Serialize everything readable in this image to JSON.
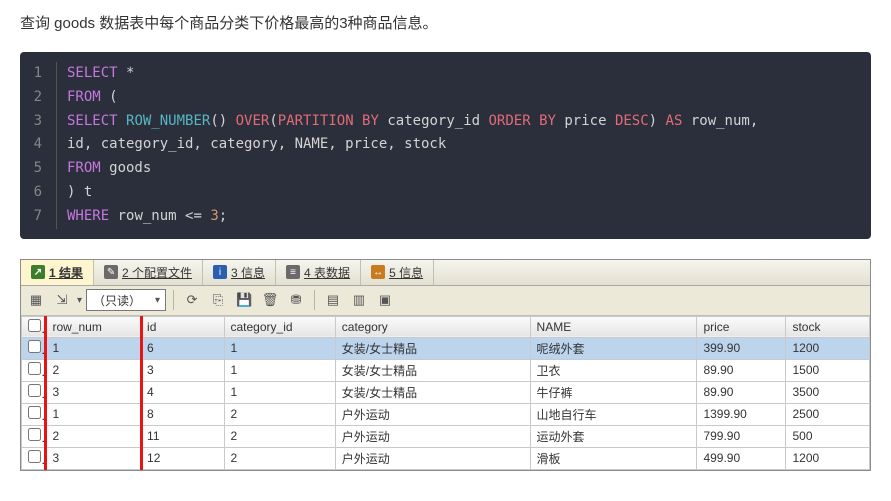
{
  "description": "查询 goods 数据表中每个商品分类下价格最高的3种商品信息。",
  "code": {
    "lines": [
      {
        "n": "1",
        "html": "<span class='kw1'>SELECT</span> <span class='star'>*</span>"
      },
      {
        "n": "2",
        "html": "<span class='kw1'>FROM</span> <span class='paren'>(</span>"
      },
      {
        "n": "3",
        "html": "<span class='kw1'>SELECT</span> <span class='fn'>ROW_NUMBER</span><span class='paren'>()</span> <span class='kw2'>OVER</span><span class='paren'>(</span><span class='kw2'>PARTITION BY</span> category_id <span class='kw2'>ORDER BY</span> price <span class='kw2'>DESC</span><span class='paren'>)</span> <span class='kw2'>AS</span> row_num,"
      },
      {
        "n": "4",
        "html": "id, category_id, category, NAME, price, stock"
      },
      {
        "n": "5",
        "html": "<span class='kw1'>FROM</span> goods"
      },
      {
        "n": "6",
        "html": "<span class='paren'>)</span> t"
      },
      {
        "n": "7",
        "html": "<span class='kw1'>WHERE</span> row_num <span class='op'>&lt;=</span> <span class='num'>3</span>;"
      }
    ]
  },
  "tabs": {
    "t1": {
      "icon_text": "↗",
      "label": "1 结果"
    },
    "t2": {
      "icon_text": "✎",
      "label": "2 个配置文件"
    },
    "t3": {
      "icon_text": "i",
      "label": "3 信息"
    },
    "t4": {
      "icon_text": "≡",
      "label": "4 表数据"
    },
    "t5": {
      "icon_text": "↔",
      "label": "5 信息"
    }
  },
  "toolbar": {
    "dropdown_label": "（只读）"
  },
  "grid": {
    "headers": {
      "row_num": "row_num",
      "id": "id",
      "category_id": "category_id",
      "category": "category",
      "name": "NAME",
      "price": "price",
      "stock": "stock"
    },
    "rows": [
      {
        "row_num": "1",
        "id": "6",
        "category_id": "1",
        "category": "女装/女士精品",
        "name": "呢绒外套",
        "price": "399.90",
        "stock": "1200",
        "selected": true
      },
      {
        "row_num": "2",
        "id": "3",
        "category_id": "1",
        "category": "女装/女士精品",
        "name": "卫衣",
        "price": "89.90",
        "stock": "1500"
      },
      {
        "row_num": "3",
        "id": "4",
        "category_id": "1",
        "category": "女装/女士精品",
        "name": "牛仔裤",
        "price": "89.90",
        "stock": "3500"
      },
      {
        "row_num": "1",
        "id": "8",
        "category_id": "2",
        "category": "户外运动",
        "name": "山地自行车",
        "price": "1399.90",
        "stock": "2500"
      },
      {
        "row_num": "2",
        "id": "11",
        "category_id": "2",
        "category": "户外运动",
        "name": "运动外套",
        "price": "799.90",
        "stock": "500"
      },
      {
        "row_num": "3",
        "id": "12",
        "category_id": "2",
        "category": "户外运动",
        "name": "滑板",
        "price": "499.90",
        "stock": "1200"
      }
    ]
  },
  "chart_data": {
    "type": "table",
    "title": "Top 3 priced goods per category",
    "columns": [
      "row_num",
      "id",
      "category_id",
      "category",
      "NAME",
      "price",
      "stock"
    ],
    "data": [
      [
        1,
        6,
        1,
        "女装/女士精品",
        "呢绒外套",
        399.9,
        1200
      ],
      [
        2,
        3,
        1,
        "女装/女士精品",
        "卫衣",
        89.9,
        1500
      ],
      [
        3,
        4,
        1,
        "女装/女士精品",
        "牛仔裤",
        89.9,
        3500
      ],
      [
        1,
        8,
        2,
        "户外运动",
        "山地自行车",
        1399.9,
        2500
      ],
      [
        2,
        11,
        2,
        "户外运动",
        "运动外套",
        799.9,
        500
      ],
      [
        3,
        12,
        2,
        "户外运动",
        "滑板",
        499.9,
        1200
      ]
    ]
  }
}
